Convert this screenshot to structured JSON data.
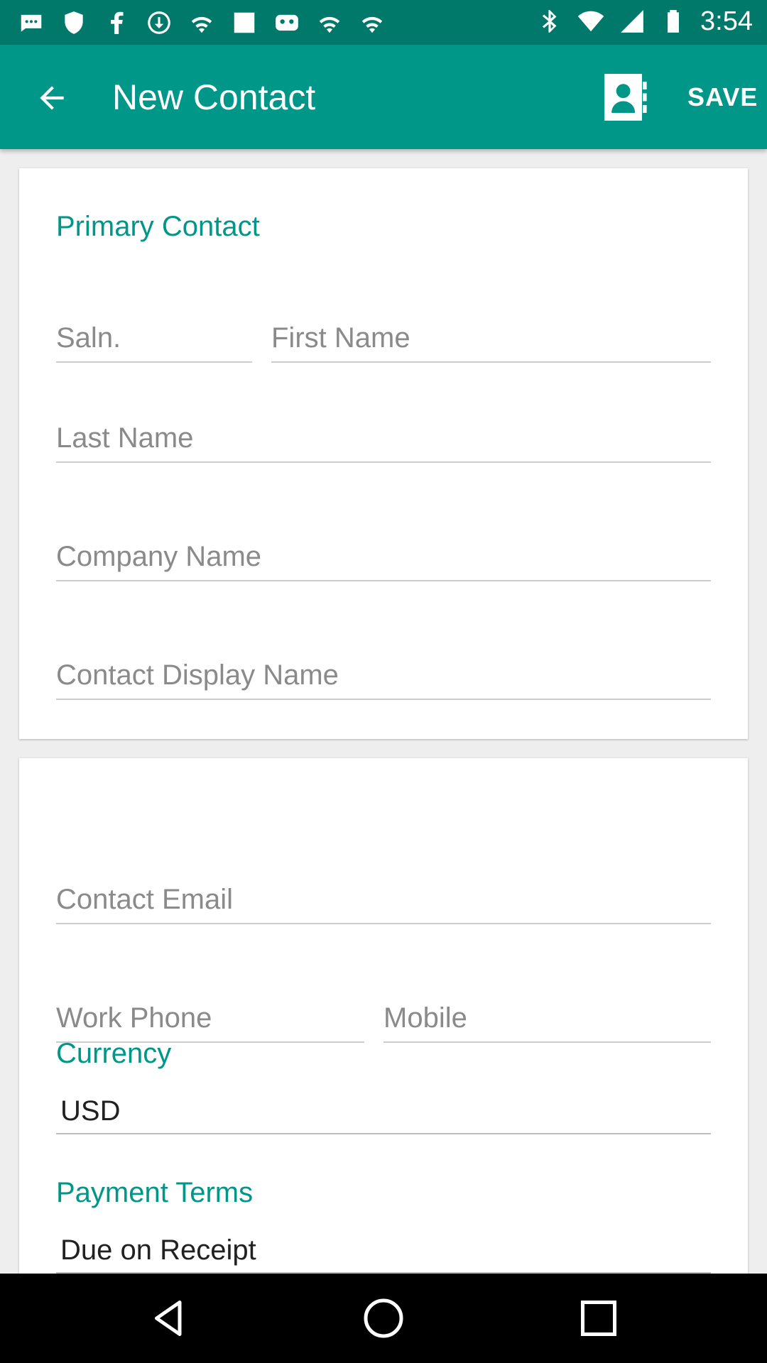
{
  "status_bar": {
    "time": "3:54",
    "left_icons": [
      "message-icon",
      "shield-icon",
      "facebook-icon",
      "download-icon",
      "wifi-icon",
      "square-icon",
      "gamepad-icon",
      "wifi-icon",
      "wifi-icon"
    ],
    "right_icons": [
      "bluetooth-icon",
      "wifi-icon",
      "signal-icon",
      "battery-icon"
    ]
  },
  "app_bar": {
    "title": "New Contact",
    "save_label": "SAVE",
    "color": "#009688",
    "status_color": "#00796b"
  },
  "primary_contact": {
    "section_label": "Primary Contact",
    "salutation_placeholder": "Saln.",
    "first_name_placeholder": "First Name",
    "last_name_placeholder": "Last Name",
    "company_name_placeholder": "Company Name",
    "display_name_placeholder": "Contact Display Name"
  },
  "contact_details": {
    "email_placeholder": "Contact Email",
    "work_phone_placeholder": "Work Phone",
    "mobile_placeholder": "Mobile",
    "currency_label": "Currency",
    "currency_value": "USD",
    "payment_terms_label": "Payment Terms",
    "payment_terms_value": "Due on Receipt"
  },
  "accent_color": "#009688"
}
